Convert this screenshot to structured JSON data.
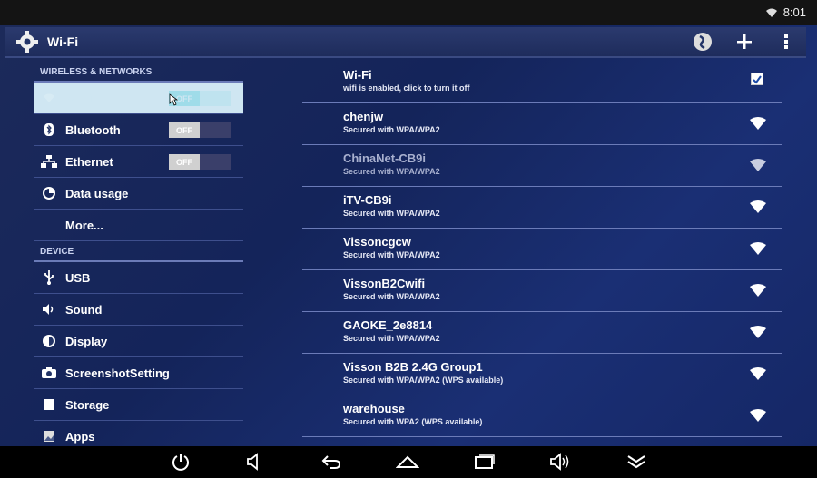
{
  "status": {
    "time": "8:01"
  },
  "action_bar": {
    "title": "Wi-Fi"
  },
  "sections": {
    "wireless": "WIRELESS & NETWORKS",
    "device": "DEVICE"
  },
  "menu": {
    "wifi": {
      "label": "Wi-Fi",
      "toggle": "OFF"
    },
    "bluetooth": {
      "label": "Bluetooth",
      "toggle": "OFF"
    },
    "ethernet": {
      "label": "Ethernet",
      "toggle": "OFF"
    },
    "data_usage": {
      "label": "Data usage"
    },
    "more": {
      "label": "More..."
    },
    "usb": {
      "label": "USB"
    },
    "sound": {
      "label": "Sound"
    },
    "display": {
      "label": "Display"
    },
    "screenshot": {
      "label": "ScreenshotSetting"
    },
    "storage": {
      "label": "Storage"
    },
    "apps": {
      "label": "Apps"
    }
  },
  "wifi_panel": {
    "title": "Wi-Fi",
    "subtitle": "wifi is enabled, click to turn it off",
    "networks": [
      {
        "name": "chenjw",
        "security": "Secured with WPA/WPA2"
      },
      {
        "name": "ChinaNet-CB9i",
        "security": "Secured with WPA/WPA2"
      },
      {
        "name": "iTV-CB9i",
        "security": "Secured with WPA/WPA2"
      },
      {
        "name": "Vissoncgcw",
        "security": "Secured with WPA/WPA2"
      },
      {
        "name": "VissonB2Cwifi",
        "security": "Secured with WPA/WPA2"
      },
      {
        "name": "GAOKE_2e8814",
        "security": "Secured with WPA/WPA2"
      },
      {
        "name": "Visson B2B 2.4G Group1",
        "security": "Secured with WPA/WPA2 (WPS available)"
      },
      {
        "name": "warehouse",
        "security": "Secured with WPA2 (WPS available)"
      }
    ]
  }
}
